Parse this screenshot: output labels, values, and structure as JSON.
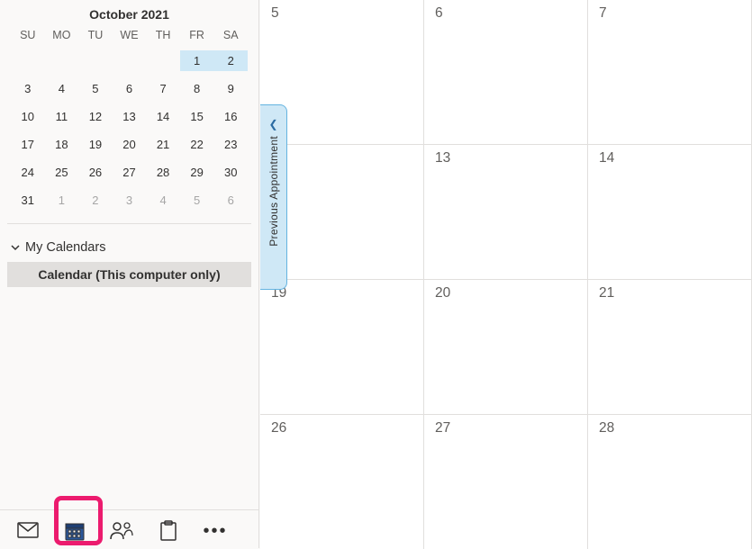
{
  "miniCalendar": {
    "title": "October 2021",
    "dow": [
      "SU",
      "MO",
      "TU",
      "WE",
      "TH",
      "FR",
      "SA"
    ],
    "cells": [
      {
        "n": "",
        "other": false
      },
      {
        "n": "",
        "other": false
      },
      {
        "n": "",
        "other": false
      },
      {
        "n": "",
        "other": false
      },
      {
        "n": "",
        "other": false
      },
      {
        "n": "1",
        "other": false,
        "hl": true
      },
      {
        "n": "2",
        "other": false,
        "hl": true
      },
      {
        "n": "3",
        "other": false
      },
      {
        "n": "4",
        "other": false
      },
      {
        "n": "5",
        "other": false
      },
      {
        "n": "6",
        "other": false
      },
      {
        "n": "7",
        "other": false
      },
      {
        "n": "8",
        "other": false
      },
      {
        "n": "9",
        "other": false
      },
      {
        "n": "10",
        "other": false
      },
      {
        "n": "11",
        "other": false
      },
      {
        "n": "12",
        "other": false
      },
      {
        "n": "13",
        "other": false
      },
      {
        "n": "14",
        "other": false
      },
      {
        "n": "15",
        "other": false
      },
      {
        "n": "16",
        "other": false
      },
      {
        "n": "17",
        "other": false
      },
      {
        "n": "18",
        "other": false
      },
      {
        "n": "19",
        "other": false
      },
      {
        "n": "20",
        "other": false
      },
      {
        "n": "21",
        "other": false
      },
      {
        "n": "22",
        "other": false
      },
      {
        "n": "23",
        "other": false
      },
      {
        "n": "24",
        "other": false
      },
      {
        "n": "25",
        "other": false
      },
      {
        "n": "26",
        "other": false
      },
      {
        "n": "27",
        "other": false
      },
      {
        "n": "28",
        "other": false
      },
      {
        "n": "29",
        "other": false
      },
      {
        "n": "30",
        "other": false
      },
      {
        "n": "31",
        "other": false
      },
      {
        "n": "1",
        "other": true
      },
      {
        "n": "2",
        "other": true
      },
      {
        "n": "3",
        "other": true
      },
      {
        "n": "4",
        "other": true
      },
      {
        "n": "5",
        "other": true
      },
      {
        "n": "6",
        "other": true
      }
    ]
  },
  "calendarsSection": {
    "header": "My Calendars",
    "items": [
      {
        "label": "Calendar (This computer only)"
      }
    ]
  },
  "prevApptTab": {
    "label": "Previous Appointment"
  },
  "monthGrid": {
    "cells": [
      "5",
      "6",
      "7",
      "",
      "13",
      "14",
      "19",
      "20",
      "21",
      "26",
      "27",
      "28"
    ]
  },
  "bottomNav": {
    "mail": "mail-icon",
    "calendar": "calendar-icon",
    "people": "people-icon",
    "tasks": "tasks-icon",
    "overflow": "ellipsis-icon"
  }
}
